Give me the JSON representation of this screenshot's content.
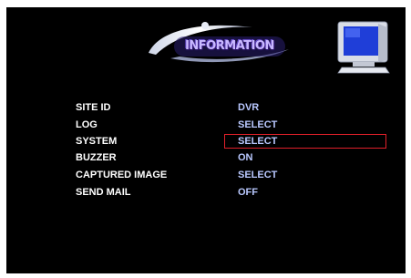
{
  "header": {
    "title": "INFORMATION",
    "logo_icon": "information-logo-icon",
    "monitor_icon": "monitor-icon"
  },
  "menu": {
    "items": [
      {
        "label": "SITE ID",
        "value": "DVR"
      },
      {
        "label": "LOG",
        "value": "SELECT"
      },
      {
        "label": "SYSTEM",
        "value": "SELECT"
      },
      {
        "label": "BUZZER",
        "value": "ON"
      },
      {
        "label": "CAPTURED IMAGE",
        "value": "SELECT"
      },
      {
        "label": "SEND MAIL",
        "value": "OFF"
      }
    ],
    "selected_index": 2
  },
  "colors": {
    "background": "#000000",
    "label": "#ffffff",
    "value": "#b9c8ff",
    "selection": "#e0202a",
    "title": "#c8b8ff"
  }
}
